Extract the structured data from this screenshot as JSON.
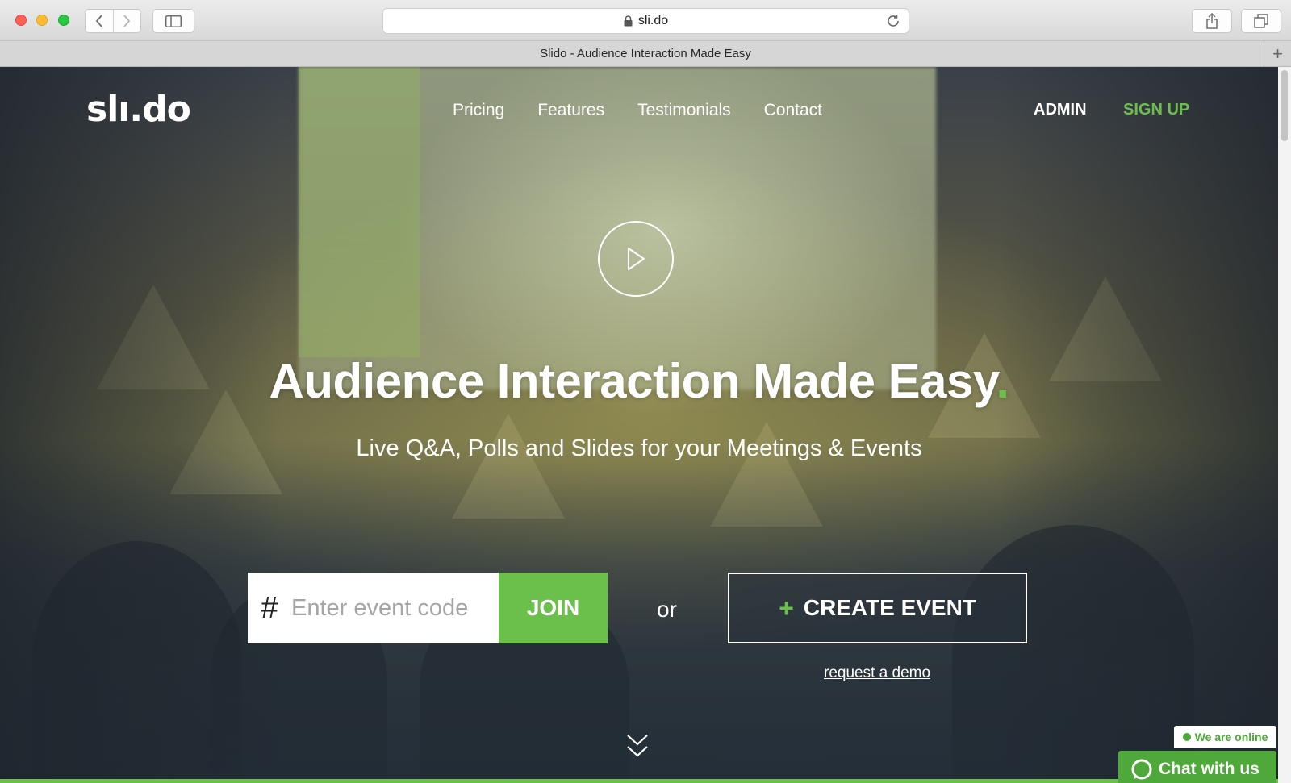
{
  "browser": {
    "url": "sli.do",
    "tab_title": "Slido - Audience Interaction Made Easy"
  },
  "header": {
    "logo": "slı.do",
    "nav": [
      "Pricing",
      "Features",
      "Testimonials",
      "Contact"
    ],
    "admin": "ADMIN",
    "signup": "SIGN UP"
  },
  "hero": {
    "headline": "Audience Interaction Made Easy",
    "headline_dot": ".",
    "subheadline": "Live Q&A, Polls and Slides for your Meetings & Events"
  },
  "join": {
    "prefix": "#",
    "placeholder": "Enter event code",
    "value": "",
    "button": "JOIN"
  },
  "or_label": "or",
  "create": {
    "plus": "+",
    "label": "CREATE EVENT"
  },
  "demo_link": "request a demo",
  "chat": {
    "status": "We are online",
    "button": "Chat with us"
  },
  "colors": {
    "accent": "#6bc04b",
    "chat_green": "#4ea83a"
  },
  "icons": [
    "play-icon",
    "chevron-down-icon",
    "lock-icon",
    "reload-icon",
    "share-icon",
    "tabs-icon",
    "sidebar-icon",
    "chat-bubble-icon"
  ]
}
